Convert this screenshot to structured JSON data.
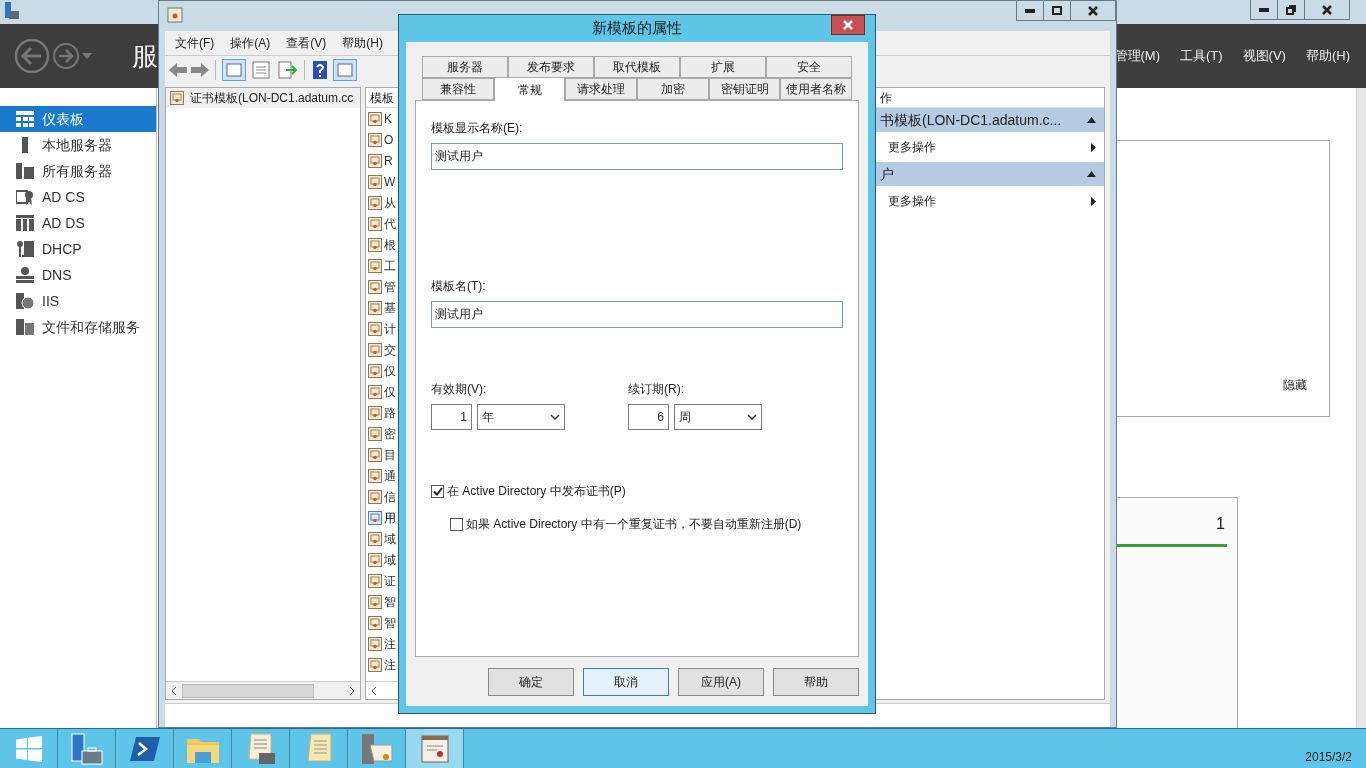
{
  "server_manager": {
    "header_title": "服",
    "menu": [
      "管理(M)",
      "工具(T)",
      "视图(V)",
      "帮助(H)"
    ],
    "sidebar": [
      {
        "label": "仪表板",
        "kind": "dashboard",
        "selected": true
      },
      {
        "label": "本地服务器",
        "kind": "server",
        "selected": false
      },
      {
        "label": "所有服务器",
        "kind": "servers",
        "selected": false
      },
      {
        "label": "AD CS",
        "kind": "adcs",
        "selected": false
      },
      {
        "label": "AD DS",
        "kind": "adds",
        "selected": false
      },
      {
        "label": "DHCP",
        "kind": "dhcp",
        "selected": false
      },
      {
        "label": "DNS",
        "kind": "dns",
        "selected": false
      },
      {
        "label": "IIS",
        "kind": "iis",
        "selected": false
      },
      {
        "label": "文件和存储服务",
        "kind": "files",
        "selected": false
      }
    ],
    "hide_link": "隐藏",
    "tile_count": "1"
  },
  "console": {
    "menu": [
      "文件(F)",
      "操作(A)",
      "查看(V)",
      "帮助(H)"
    ],
    "tree": [
      {
        "label": "证书模板(LON-DC1.adatum.cc",
        "selected": false
      }
    ],
    "list_header": "模板",
    "templates": [
      {
        "label": "K",
        "selected": false
      },
      {
        "label": "O",
        "selected": false
      },
      {
        "label": "R",
        "selected": false
      },
      {
        "label": "W",
        "selected": false
      },
      {
        "label": "从",
        "selected": false
      },
      {
        "label": "代",
        "selected": false
      },
      {
        "label": "根",
        "selected": false
      },
      {
        "label": "工",
        "selected": false
      },
      {
        "label": "管",
        "selected": false
      },
      {
        "label": "基",
        "selected": false
      },
      {
        "label": "计",
        "selected": false
      },
      {
        "label": "交",
        "selected": false
      },
      {
        "label": "仅",
        "selected": false
      },
      {
        "label": "仅",
        "selected": false
      },
      {
        "label": "路",
        "selected": false
      },
      {
        "label": "密",
        "selected": false
      },
      {
        "label": "目",
        "selected": false
      },
      {
        "label": "通",
        "selected": false
      },
      {
        "label": "信",
        "selected": false
      },
      {
        "label": "用",
        "selected": true
      },
      {
        "label": "域",
        "selected": false
      },
      {
        "label": "域",
        "selected": false
      },
      {
        "label": "证",
        "selected": false
      },
      {
        "label": "智",
        "selected": false
      },
      {
        "label": "智",
        "selected": false
      },
      {
        "label": "注",
        "selected": false
      },
      {
        "label": "注",
        "selected": false
      }
    ],
    "actions": {
      "header": "作",
      "groups": [
        {
          "title": "书模板(LON-DC1.adatum.c...",
          "expanded": true,
          "items": [
            "更多操作"
          ]
        },
        {
          "title": "户",
          "expanded": true,
          "items": [
            "更多操作"
          ]
        }
      ]
    }
  },
  "dialog": {
    "title": "新模板的属性",
    "tab_rows": [
      [
        {
          "label": "服务器",
          "selected": false
        },
        {
          "label": "发布要求",
          "selected": false
        },
        {
          "label": "取代模板",
          "selected": false
        },
        {
          "label": "扩展",
          "selected": false
        },
        {
          "label": "安全",
          "selected": false
        }
      ],
      [
        {
          "label": "兼容性",
          "selected": false
        },
        {
          "label": "常规",
          "selected": true
        },
        {
          "label": "请求处理",
          "selected": false
        },
        {
          "label": "加密",
          "selected": false
        },
        {
          "label": "密钥证明",
          "selected": false
        },
        {
          "label": "使用者名称",
          "selected": false
        }
      ]
    ],
    "display_name": {
      "label": "模板显示名称(E):",
      "value": "测试用户"
    },
    "template_name": {
      "label": "模板名(T):",
      "value": "测试用户"
    },
    "validity": {
      "label": "有效期(V):",
      "number": "1",
      "unit": "年"
    },
    "renewal": {
      "label": "续订期(R):",
      "number": "6",
      "unit": "周"
    },
    "checkboxes": [
      {
        "label": "在 Active Directory 中发布证书(P)",
        "checked": true,
        "children": [
          {
            "label": "如果 Active Directory 中有一个重复证书，不要自动重新注册(D)",
            "checked": false
          }
        ]
      }
    ],
    "buttons": [
      {
        "label": "确定",
        "selected": false
      },
      {
        "label": "取消",
        "selected": true
      },
      {
        "label": "应用(A)",
        "selected": false
      },
      {
        "label": "帮助",
        "selected": false
      }
    ]
  },
  "taskbar": {
    "apps": [
      {
        "kind": "start",
        "selected": false
      },
      {
        "kind": "server-manager",
        "selected": false
      },
      {
        "kind": "powershell",
        "selected": false
      },
      {
        "kind": "folder",
        "selected": false
      },
      {
        "kind": "scroll-tools",
        "selected": false
      },
      {
        "kind": "scroll",
        "selected": false
      },
      {
        "kind": "server-cert",
        "selected": false
      },
      {
        "kind": "certificate",
        "selected": true
      }
    ],
    "date": "2015/3/2"
  }
}
